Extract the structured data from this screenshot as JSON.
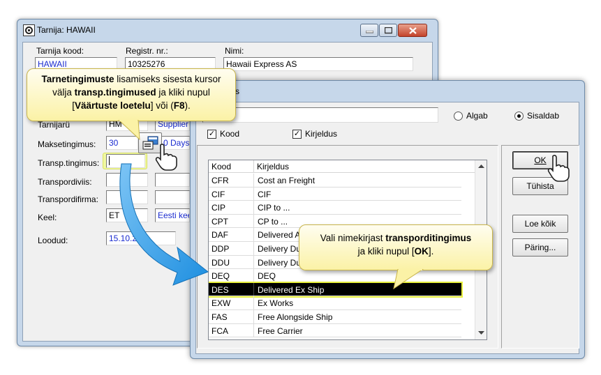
{
  "supplier_window": {
    "title": "Tarnija: HAWAII",
    "labels": {
      "code": "Tarnija kood:",
      "reg_no": "Registr. nr.:",
      "name": "Nimi:",
      "supplier_group": "Tarnijarü",
      "payment_terms": "Maksetingimus:",
      "delivery_terms": "Transp.tingimus:",
      "transport_method": "Transpordiviis:",
      "transport_company": "Transpordifirma:",
      "language": "Keel:",
      "created": "Loodud:"
    },
    "values": {
      "code": "HAWAII",
      "reg_no": "10325276",
      "name": "Hawaii Express AS",
      "group_code": "HM",
      "group_desc": "Supplier",
      "payment_code": "30",
      "payment_desc": "0 Days",
      "language_code": "ET",
      "language_desc": "Eesti kee",
      "created": "15.10.20"
    }
  },
  "lookup_dialog": {
    "title_fragment": "s",
    "radio_begins": "Algab",
    "radio_contains": "Sisaldab",
    "check_code": "Kood",
    "check_desc": "Kirjeldus",
    "buttons": {
      "ok": "OK",
      "cancel": "Tühista",
      "read_all": "Loe kõik",
      "query": "Päring..."
    },
    "columns": [
      "Kood",
      "Kirjeldus"
    ],
    "rows": [
      {
        "code": "CFR",
        "desc": "Cost an Freight"
      },
      {
        "code": "CIF",
        "desc": "CIF"
      },
      {
        "code": "CIP",
        "desc": "CIP to ..."
      },
      {
        "code": "CPT",
        "desc": "CP to ..."
      },
      {
        "code": "DAF",
        "desc": "Delivered A"
      },
      {
        "code": "DDP",
        "desc": "Delivery Du"
      },
      {
        "code": "DDU",
        "desc": "Delivery Du"
      },
      {
        "code": "DEQ",
        "desc": "DEQ"
      },
      {
        "code": "DES",
        "desc": "Delivered Ex Ship"
      },
      {
        "code": "EXW",
        "desc": "Ex Works"
      },
      {
        "code": "FAS",
        "desc": "Free Alongside Ship"
      },
      {
        "code": "FCA",
        "desc": "Free Carrier"
      }
    ],
    "selected_code": "DES"
  },
  "callouts": {
    "first": {
      "b1": "Tarnetingimuste",
      "t1": " lisamiseks sisesta kursor välja ",
      "b2": "transp.tingimused",
      "t2": " ja kliki nupul [",
      "b3": "Väärtuste loetelu",
      "t3": "] või (",
      "b4": "F8",
      "t4": ")."
    },
    "second": {
      "t1": "Vali nimekirjast ",
      "b1": "transporditingimus",
      "t2": " ja kliki nupul [",
      "b2": "OK",
      "t3": "]."
    }
  },
  "colors": {
    "highlight": "#e8f03c",
    "arrow": "#1e8fe0",
    "callout_fill": "#fbf2a6",
    "window_frame": "#c6d7ea"
  }
}
